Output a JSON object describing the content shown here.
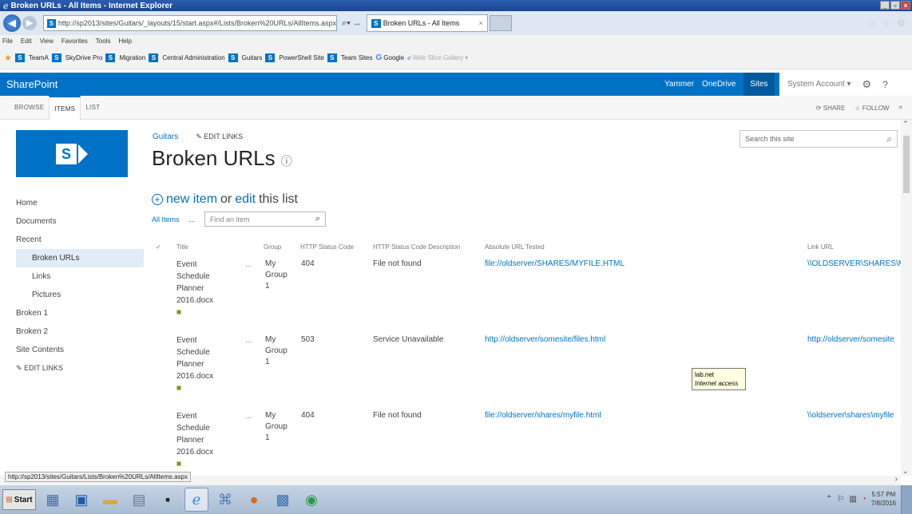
{
  "window": {
    "title": "Broken URLs - All Items - Internet Explorer",
    "address": "http://sp2013/sites/Guitars/_layouts/15/start.aspx#/Lists/Broken%20URLs/AllItems.aspx",
    "tab_title": "Broken URLs - All Items",
    "status_url": "http://sp2013/sites/Guitars/Lists/Broken%20URLs/AllItems.aspx"
  },
  "menu": [
    "File",
    "Edit",
    "View",
    "Favorites",
    "Tools",
    "Help"
  ],
  "favorites": [
    {
      "label": "TeamA",
      "icon": "sharepoint-icon"
    },
    {
      "label": "SkyDrive Pro",
      "icon": "sharepoint-icon"
    },
    {
      "label": "Migration",
      "icon": "sharepoint-icon"
    },
    {
      "label": "Central Administration",
      "icon": "sharepoint-icon"
    },
    {
      "label": "Guitars",
      "icon": "sharepoint-icon"
    },
    {
      "label": "PowerShell Site",
      "icon": "sharepoint-icon"
    },
    {
      "label": "Team Sites",
      "icon": "sharepoint-icon"
    },
    {
      "label": "Google",
      "icon": "google-icon"
    },
    {
      "label": "Web Slice Gallery",
      "icon": "ie-icon"
    }
  ],
  "suitebar": {
    "brand": "SharePoint",
    "links": [
      "Yammer",
      "OneDrive",
      "Sites"
    ],
    "account": "System Account",
    "account_caret": "▾",
    "accent": "#0072c6"
  },
  "ribbon": {
    "tabs": [
      "BROWSE",
      "ITEMS",
      "LIST"
    ],
    "share": "SHARE",
    "follow": "FOLLOW"
  },
  "breadcrumb": {
    "site": "Guitars",
    "edit": "EDIT LINKS"
  },
  "page_title": "Broken URLs",
  "search_placeholder": "Search this site",
  "quicklaunch": {
    "items": [
      "Home",
      "Documents",
      "Recent"
    ],
    "recent": [
      "Broken URLs",
      "Links",
      "Pictures"
    ],
    "more": [
      "Broken 1",
      "Broken 2",
      "Site Contents"
    ],
    "edit": "EDIT LINKS"
  },
  "list_toolbar": {
    "new_item": "new item",
    "or": "or",
    "edit": "edit",
    "this_list": "this list",
    "view": "All Items",
    "more": "...",
    "find_placeholder": "Find an item"
  },
  "columns": {
    "check": "✓",
    "title": "Title",
    "group": "Group",
    "code": "HTTP Status Code",
    "desc": "HTTP Status Code Description",
    "url": "Absolute URL Tested",
    "link": "Link URL"
  },
  "rows": [
    {
      "title": [
        "Event",
        "Schedule",
        "Planner",
        "2016.docx"
      ],
      "group": [
        "My",
        "Group",
        "1"
      ],
      "code": "404",
      "desc": "File not found",
      "url": "file://oldserver/SHARES/MYFILE.HTML",
      "link": "\\\\OLDSERVER\\SHARES\\M"
    },
    {
      "title": [
        "Event",
        "Schedule",
        "Planner",
        "2016.docx"
      ],
      "group": [
        "My",
        "Group",
        "1"
      ],
      "code": "503",
      "desc": "Service Unavailable",
      "url": "http://oldserver/somesite/files.html",
      "link": "http://oldserver/somesite"
    },
    {
      "title": [
        "Event",
        "Schedule",
        "Planner",
        "2016.docx"
      ],
      "group": [
        "My",
        "Group",
        "1"
      ],
      "code": "404",
      "desc": "File not found",
      "url": "file://oldserver/shares/myfile.html",
      "link": "\\\\oldserver\\shares\\myfile"
    }
  ],
  "row_menu": "...",
  "tooltip": {
    "line1": "lab.net",
    "line2": "Internet access"
  },
  "taskbar": {
    "start": "Start",
    "time": "5:57 PM",
    "date": "7/8/2016"
  }
}
